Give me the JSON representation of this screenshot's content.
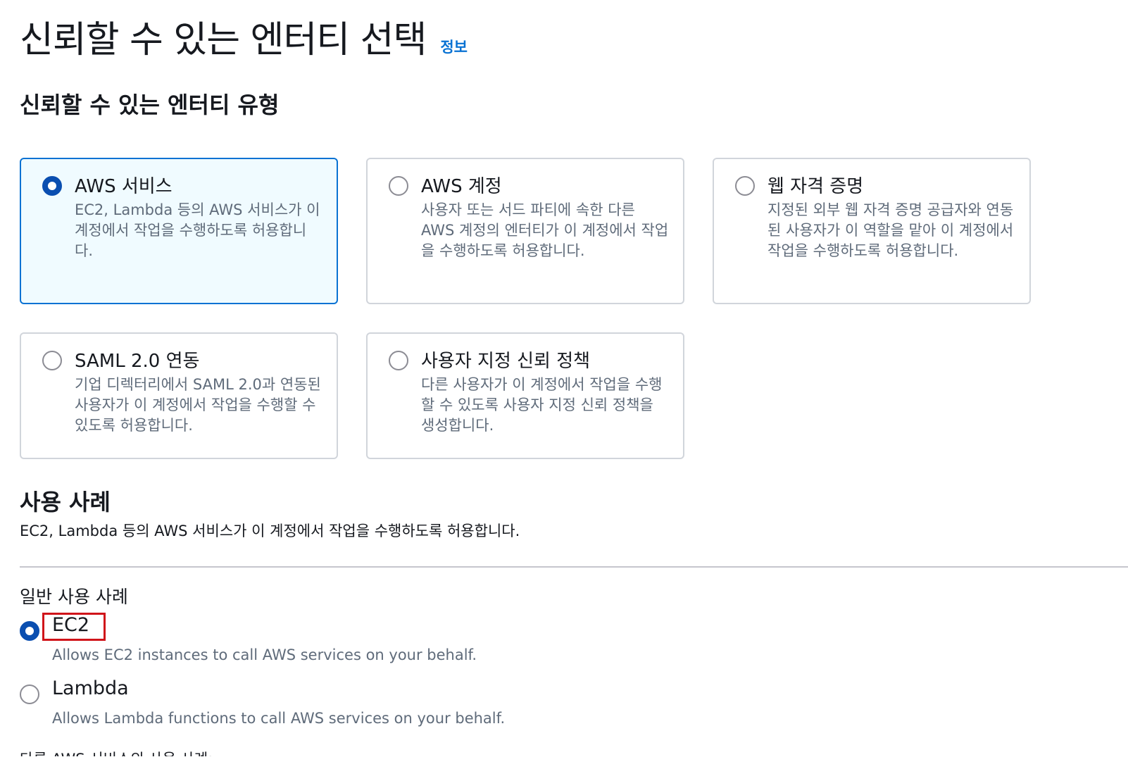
{
  "header": {
    "title": "신뢰할 수 있는 엔터티 선택",
    "info_link": "정보"
  },
  "entity_type": {
    "title": "신뢰할 수 있는 엔터티 유형",
    "tiles": [
      {
        "label": "AWS 서비스",
        "desc": "EC2, Lambda 등의 AWS 서비스가 이 계정에서 작업을 수행하도록 허용합니다.",
        "selected": true
      },
      {
        "label": "AWS 계정",
        "desc": "사용자 또는 서드 파티에 속한 다른 AWS 계정의 엔터티가 이 계정에서 작업을 수행하도록 허용합니다.",
        "selected": false
      },
      {
        "label": "웹 자격 증명",
        "desc": "지정된 외부 웹 자격 증명 공급자와 연동된 사용자가 이 역할을 맡아 이 계정에서 작업을 수행하도록 허용합니다.",
        "selected": false
      },
      {
        "label": "SAML 2.0 연동",
        "desc": "기업 디렉터리에서 SAML 2.0과 연동된 사용자가 이 계정에서 작업을 수행할 수 있도록 허용합니다.",
        "selected": false
      },
      {
        "label": "사용자 지정 신뢰 정책",
        "desc": "다른 사용자가 이 계정에서 작업을 수행할 수 있도록 사용자 지정 신뢰 정책을 생성합니다.",
        "selected": false
      }
    ]
  },
  "use_case": {
    "title": "사용 사례",
    "desc": "EC2, Lambda 등의 AWS 서비스가 이 계정에서 작업을 수행하도록 허용합니다.",
    "common_label": "일반 사용 사례",
    "options": [
      {
        "label": "EC2",
        "desc": "Allows EC2 instances to call AWS services on your behalf.",
        "selected": true
      },
      {
        "label": "Lambda",
        "desc": "Allows Lambda functions to call AWS services on your behalf.",
        "selected": false
      }
    ],
    "other_label": "다른 AWS 서비스의 사용 사례:"
  },
  "colors": {
    "accent": "#0972d3",
    "selected_radio": "#0a4eb0",
    "selected_tile_bg": "#f0fbff",
    "highlight": "#d0141a"
  }
}
